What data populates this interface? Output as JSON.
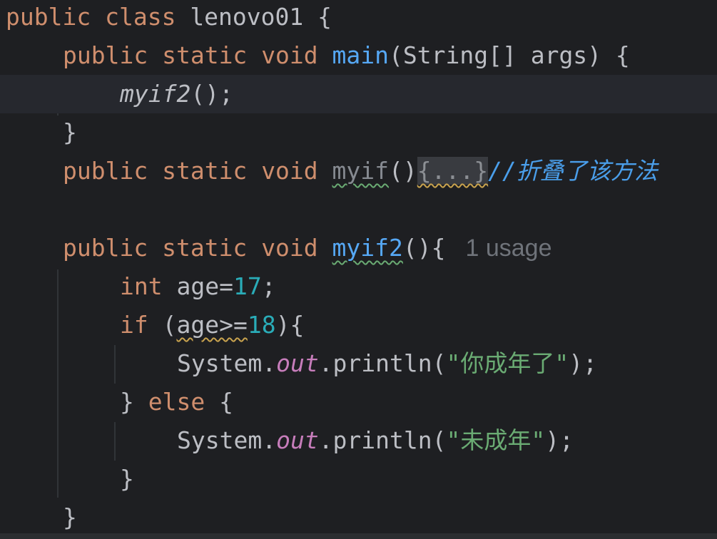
{
  "lines": {
    "l1": {
      "kw1": "public",
      "kw2": "class",
      "name": "lenovo01",
      "brace": "{"
    },
    "l2": {
      "kw1": "public",
      "kw2": "static",
      "kw3": "void",
      "fn": "main",
      "params": "(String[] args) {"
    },
    "l3": {
      "call": "myif2",
      "rest": "();"
    },
    "l4": {
      "brace": "}"
    },
    "l5": {
      "kw1": "public",
      "kw2": "static",
      "kw3": "void",
      "fn": "myif",
      "parens": "()",
      "folded": "{...}",
      "comment_prefix": "//",
      "comment_text": "折叠了该方法"
    },
    "l6": {},
    "l7": {
      "kw1": "public",
      "kw2": "static",
      "kw3": "void",
      "fn": "myif2",
      "parens": "(){",
      "inlay": "1 usage"
    },
    "l8": {
      "kw": "int",
      "var": "age=",
      "num": "17",
      "end": ";"
    },
    "l9": {
      "kw": "if",
      "open": "(",
      "cond": "age>=",
      "num": "18",
      "close": "){"
    },
    "l10": {
      "cls": "System.",
      "field": "out",
      "method": ".println(",
      "str_open": "\"",
      "str_text": "你成年了",
      "str_close": "\"",
      "end": ");"
    },
    "l11": {
      "close": "}",
      "kw": "else",
      "open": "{"
    },
    "l12": {
      "cls": "System.",
      "field": "out",
      "method": ".println(",
      "str_open": "\"",
      "str_text": "未成年",
      "str_close": "\"",
      "end": ");"
    },
    "l13": {
      "brace": "}"
    },
    "l14": {
      "brace": "}"
    }
  },
  "colors": {
    "background": "#1e1f22",
    "keyword": "#cf8e6d",
    "function": "#56a8f5",
    "number": "#2aacb8",
    "string": "#6aab73",
    "field": "#c77dbb",
    "comment": "#4a9eea",
    "text": "#bcbec4"
  }
}
